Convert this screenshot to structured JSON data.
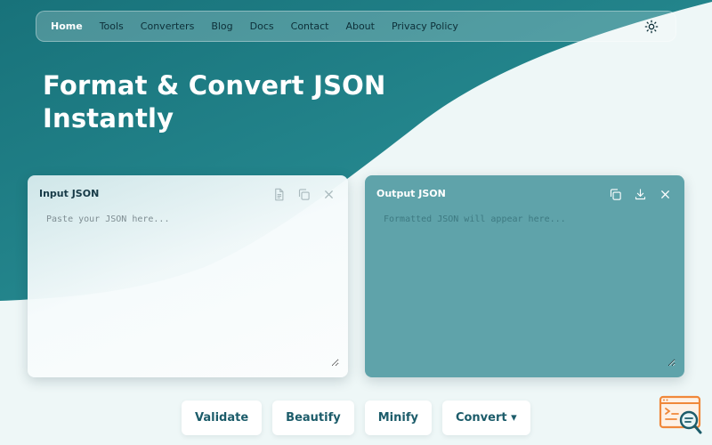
{
  "nav": {
    "items": [
      {
        "label": "Home",
        "active": true
      },
      {
        "label": "Tools"
      },
      {
        "label": "Converters"
      },
      {
        "label": "Blog"
      },
      {
        "label": "Docs"
      },
      {
        "label": "Contact"
      },
      {
        "label": "About"
      },
      {
        "label": "Privacy Policy"
      }
    ],
    "theme_icon": "sun-icon"
  },
  "hero": {
    "title_line1": "Format & Convert JSON",
    "title_line2": "Instantly"
  },
  "input_panel": {
    "title": "Input JSON",
    "placeholder": "Paste your JSON here...",
    "value": "",
    "actions": [
      "file-icon",
      "copy-icon",
      "close-icon"
    ]
  },
  "output_panel": {
    "title": "Output JSON",
    "placeholder": "Formatted JSON will appear here...",
    "value": "",
    "actions": [
      "copy-icon",
      "download-icon",
      "close-icon"
    ]
  },
  "buttons": {
    "validate": "Validate",
    "beautify": "Beautify",
    "minify": "Minify",
    "convert": "Convert ▾"
  },
  "colors": {
    "brand_teal": "#1e7f86",
    "panel_output": "#5fa3aa",
    "button_text": "#1c5c6a",
    "background": "#eef7f7"
  }
}
